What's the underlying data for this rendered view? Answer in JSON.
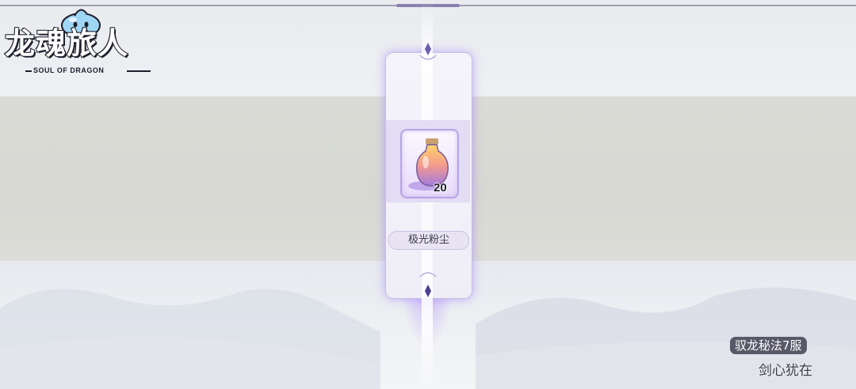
{
  "logo": {
    "title": "龙魂旅人",
    "subtitle": "SOUL OF DRAGON"
  },
  "reward": {
    "item_name": "极光粉尘",
    "quantity": "20",
    "icon": "potion-bottle-icon"
  },
  "player": {
    "server": "驭龙秘法7服",
    "name": "剑心犹在"
  },
  "colors": {
    "beam": "#b48cff",
    "card_border": "#c7bfe2",
    "server_tag_bg": "#585868"
  }
}
